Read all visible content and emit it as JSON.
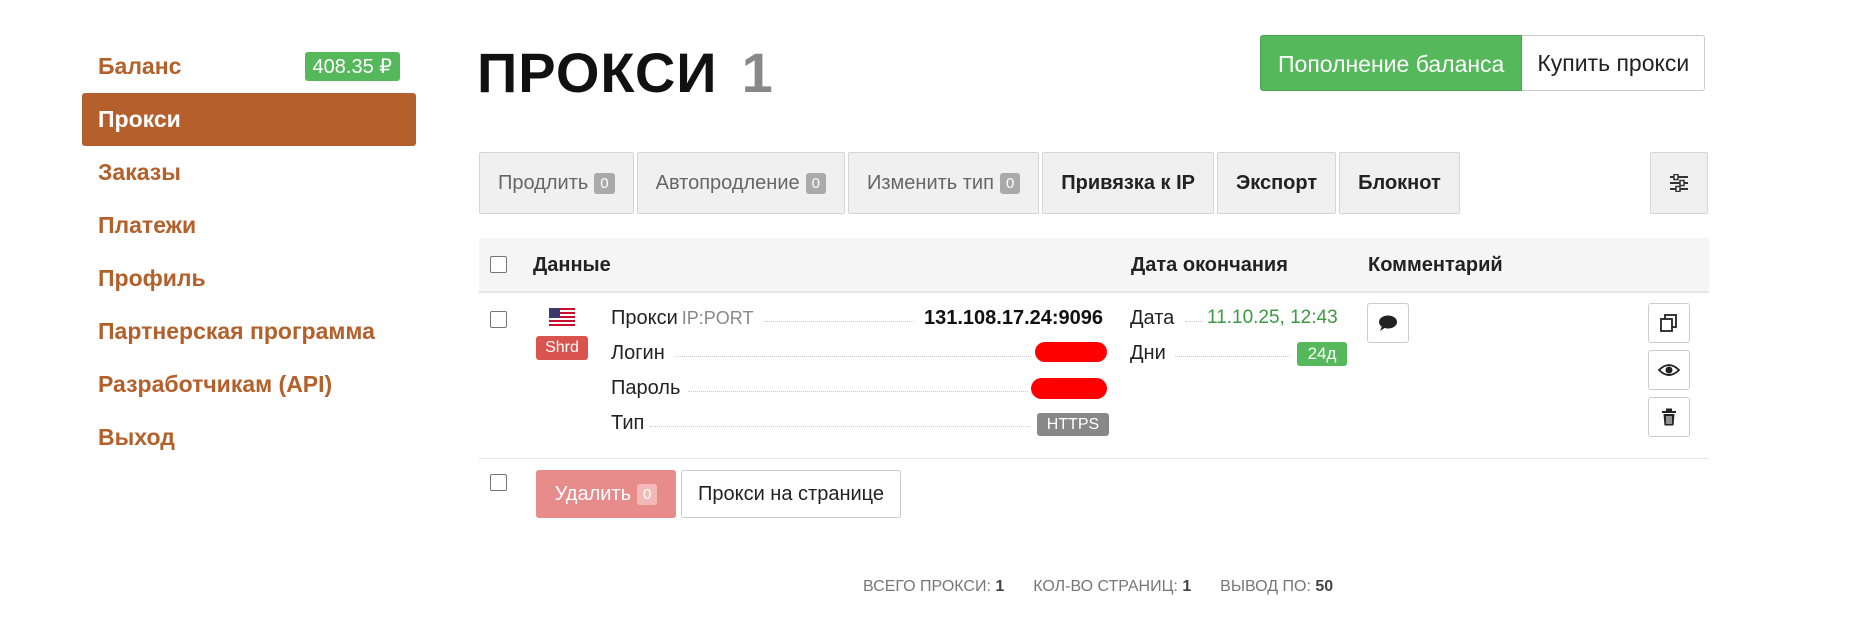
{
  "sidebar": {
    "balance_label": "Баланс",
    "balance_value": "408.35 ₽",
    "items": [
      {
        "label": "Прокси",
        "active": true
      },
      {
        "label": "Заказы"
      },
      {
        "label": "Платежи"
      },
      {
        "label": "Профиль"
      },
      {
        "label": "Партнерская программа"
      },
      {
        "label": "Разработчикам (API)"
      },
      {
        "label": "Выход"
      }
    ]
  },
  "header": {
    "title": "ПРОКСИ",
    "count": "1",
    "topup_button": "Пополнение баланса",
    "buy_button": "Купить прокси"
  },
  "toolbar": {
    "extend": {
      "label": "Продлить",
      "count": "0"
    },
    "autoextend": {
      "label": "Автопродление",
      "count": "0"
    },
    "change_type": {
      "label": "Изменить тип",
      "count": "0"
    },
    "bind_ip": "Привязка к IP",
    "export": "Экспорт",
    "notepad": "Блокнот",
    "settings_icon": "sliders-icon"
  },
  "table": {
    "columns": [
      "Данные",
      "Дата окончания",
      "Комментарий"
    ],
    "rows": [
      {
        "flag": "us-flag-icon",
        "tag": "Shrd",
        "proxy_label": "Прокси",
        "proxy_hint": "IP:PORT",
        "proxy_value": "131.108.17.24:9096",
        "login_label": "Логин",
        "password_label": "Пароль",
        "type_label": "Тип",
        "type_value": "HTTPS",
        "date_label": "Дата",
        "date_value": "11.10.25, 12:43",
        "days_label": "Дни",
        "days_value": "24д"
      }
    ]
  },
  "bottom": {
    "delete_label": "Удалить",
    "delete_count": "0",
    "per_page_label": "Прокси на странице"
  },
  "footer": {
    "total_label": "ВСЕГО ПРОКСИ:",
    "total_value": "1",
    "pages_label": "КОЛ-ВО СТРАНИЦ:",
    "pages_value": "1",
    "per_page_label": "ВЫВОД ПО:",
    "per_page_value": "50"
  },
  "colors": {
    "accent": "#b5602c",
    "success": "#55b85b",
    "danger": "#d9534f"
  }
}
